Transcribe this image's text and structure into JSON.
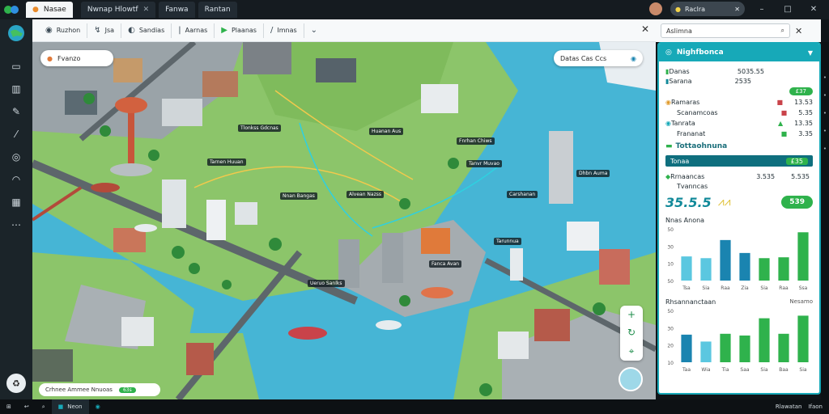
{
  "tabs": [
    {
      "label": "Nasae",
      "active": true
    },
    {
      "label": "Nwnap Hlowtf",
      "active": false
    },
    {
      "label": "Fanwa",
      "active": false
    },
    {
      "label": "Rantan",
      "active": false
    }
  ],
  "profile": {
    "name": "Raclra"
  },
  "toolbar": {
    "items": [
      {
        "icon": "compass-icon",
        "label": "Ruzhon"
      },
      {
        "icon": "route-icon",
        "label": "Jsa"
      },
      {
        "icon": "pin-icon",
        "label": "Sandias"
      },
      {
        "icon": "layers-icon",
        "label": "Aarnas"
      },
      {
        "icon": "play-icon",
        "label": "Plaanas"
      },
      {
        "icon": "pencil-icon",
        "label": "Imnas"
      }
    ]
  },
  "search": {
    "value": "Aslimna"
  },
  "map": {
    "location_pill": "Fvanzo",
    "info_pill": "Datas  Cas  Ccs",
    "footer": {
      "text": "Crhnee  Ammee  Nnuoas",
      "badge": "63s"
    },
    "labels": [
      {
        "text": "Tlonkss Gdcnas"
      },
      {
        "text": "Huanan Aus"
      },
      {
        "text": "Fnrhan Chiws"
      },
      {
        "text": "Tarnen Huuan"
      },
      {
        "text": "Tanvr Muvao"
      },
      {
        "text": "Dhbn Auma"
      },
      {
        "text": "Nnan Bangas"
      },
      {
        "text": "Alvean Nazss"
      },
      {
        "text": "Carshanan"
      },
      {
        "text": "Tarunnua"
      },
      {
        "text": "Ueruo Sanlks"
      },
      {
        "text": "Fanca Avan"
      }
    ]
  },
  "panel": {
    "title": "Nighfbonca",
    "summary": [
      {
        "label": "Danas",
        "value": "5035.55"
      },
      {
        "label": "Sarana",
        "value": "2535"
      }
    ],
    "summary_badge": "£37",
    "list": [
      {
        "label": "Ramaras",
        "value": "13.53"
      },
      {
        "label": "Scanamcoas",
        "value": "5.35"
      },
      {
        "label": "Tanrata",
        "value": "13.35"
      },
      {
        "label": "Frananat",
        "value": "3.35"
      }
    ],
    "section2_title": "Tottaohnuna",
    "bar_label": "Tonaa",
    "bar_tag": "£35",
    "metrics": [
      {
        "label": "Rrnaancas",
        "value": "3.535"
      },
      {
        "label": "Tvanncas",
        "value": "5.535"
      }
    ],
    "big_value": "35.5.5",
    "big_badge": "539",
    "colors": {
      "accent": "#17a9b8",
      "green": "#2fb24c",
      "blue": "#138a9a"
    }
  },
  "chart_data": [
    {
      "type": "bar",
      "title": "Nnas Anona",
      "categories": [
        "Tsa",
        "Sia",
        "Raa",
        "Zia",
        "Sia",
        "Raa",
        "Ssa"
      ],
      "values": [
        28,
        26,
        47,
        32,
        26,
        27,
        56
      ],
      "ylim": [
        0,
        60
      ],
      "yticks": [
        "50",
        "30",
        "10",
        "50"
      ],
      "colors": [
        "#5bc7e0",
        "#5bc7e0",
        "#1a84b0",
        "#1a84b0",
        "#2fb24c",
        "#2fb24c",
        "#2fb24c"
      ]
    },
    {
      "type": "bar",
      "title": "Rhsannanctaan",
      "subtitle": "Nesamo",
      "categories": [
        "Taa",
        "Wia",
        "Tia",
        "Saa",
        "Sia",
        "Baa",
        "Sia"
      ],
      "values": [
        32,
        24,
        33,
        31,
        51,
        33,
        54
      ],
      "ylim": [
        0,
        60
      ],
      "yticks": [
        "50",
        "30",
        "20",
        "10"
      ],
      "colors": [
        "#1a84b0",
        "#5bc7e0",
        "#2fb24c",
        "#2fb24c",
        "#2fb24c",
        "#2fb24c",
        "#2fb24c"
      ]
    }
  ],
  "taskbar": {
    "items": [
      {
        "label": "Neon"
      },
      {
        "label": "Rnan"
      }
    ],
    "clock": "Rlawatan",
    "date": "Ifaon"
  }
}
